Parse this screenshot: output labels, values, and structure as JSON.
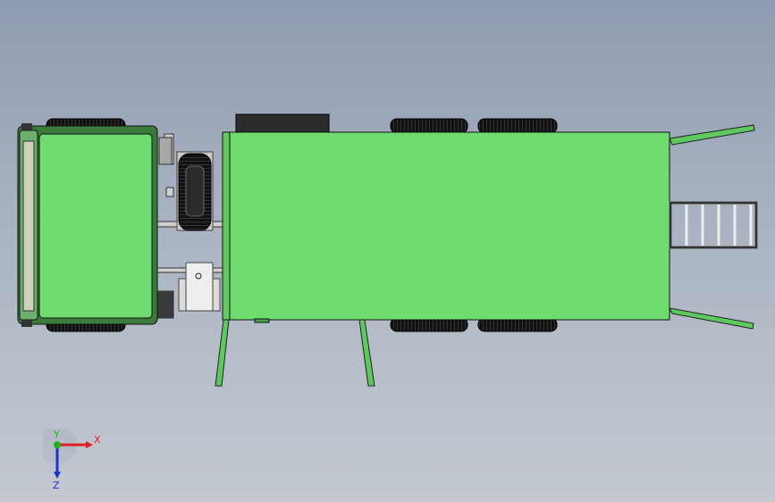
{
  "viewport": {
    "background_top": "#8f9bb0",
    "background_bottom": "#c4c9d0"
  },
  "model": {
    "body_color": "#6edc6e",
    "edge_color": "#1a1a1a",
    "tire_color": "#111111",
    "metal_color": "#d8d8d8"
  },
  "triad": {
    "x_label": "X",
    "y_label": "Y",
    "z_label": "Z",
    "x_color": "#e02020",
    "y_color": "#20b020",
    "z_color": "#2030d0"
  }
}
